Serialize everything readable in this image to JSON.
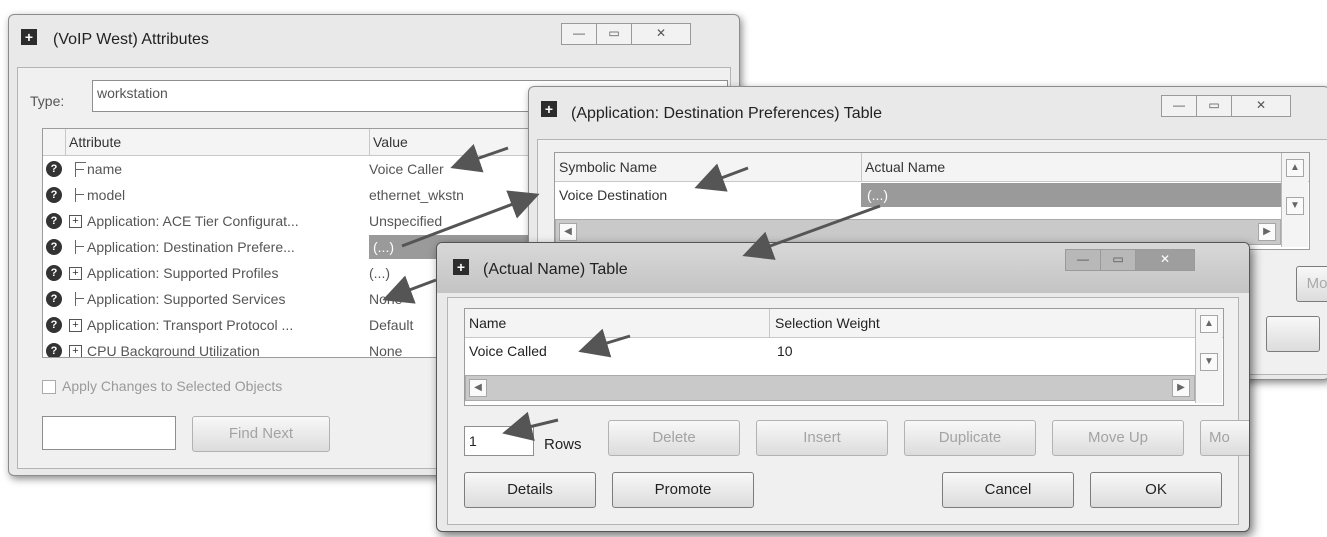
{
  "voip_window": {
    "title": "(VoIP West) Attributes",
    "type_label": "Type:",
    "type_value": "workstation",
    "columns": [
      "Attribute",
      "Value"
    ],
    "rows": [
      {
        "attribute": "name",
        "value": "Voice Caller",
        "expandable": false
      },
      {
        "attribute": "model",
        "value": "ethernet_wkstn",
        "expandable": false
      },
      {
        "attribute": "Application: ACE Tier Configurat...",
        "value": "Unspecified",
        "expandable": true
      },
      {
        "attribute": "Application: Destination Prefere...",
        "value": "(...)",
        "expandable": false
      },
      {
        "attribute": "Application: Supported Profiles",
        "value": "(...)",
        "expandable": true
      },
      {
        "attribute": "Application: Supported Services",
        "value": "None",
        "expandable": false
      },
      {
        "attribute": "Application: Transport Protocol ...",
        "value": "Default",
        "expandable": true
      },
      {
        "attribute": "CPU Background Utilization",
        "value": "None",
        "expandable": true
      }
    ],
    "apply_checkbox_label": "Apply Changes to Selected Objects",
    "find_next_label": "Find Next"
  },
  "dest_window": {
    "title": "(Application: Destination Preferences) Table",
    "columns": [
      "Symbolic Name",
      "Actual Name"
    ],
    "rows": [
      {
        "symbolic": "Voice Destination",
        "actual": "(...)"
      }
    ],
    "partial_button": "Mo"
  },
  "actual_window": {
    "title": "(Actual Name) Table",
    "columns": [
      "Name",
      "Selection Weight"
    ],
    "rows": [
      {
        "name": "Voice Called",
        "weight": "10"
      }
    ],
    "rows_value": "1",
    "rows_label": "Rows",
    "delete_label": "Delete",
    "insert_label": "Insert",
    "duplicate_label": "Duplicate",
    "moveup_label": "Move Up",
    "partial_label": "Mo",
    "details_label": "Details",
    "promote_label": "Promote",
    "cancel_label": "Cancel",
    "ok_label": "OK"
  },
  "caption_buttons": {
    "minimize": "—",
    "maximize": "▭",
    "close": "✕"
  },
  "icons": {
    "window": "window-menu-icon",
    "help": "question-icon",
    "expand": "plus-box-icon",
    "annotation": "arrow-icon"
  }
}
